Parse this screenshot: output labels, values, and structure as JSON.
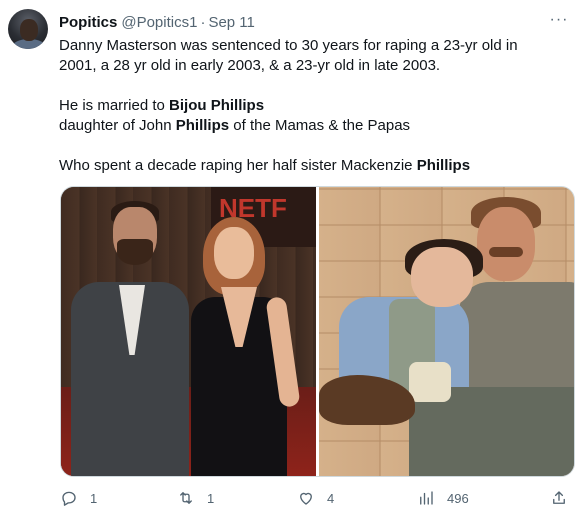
{
  "author": {
    "name": "Popitics",
    "handle": "@Popitics1",
    "separator": "·",
    "date": "Sep 11"
  },
  "more_label": "···",
  "tweet_text": {
    "line1": "Danny Masterson was sentenced to 30 years for raping a 23-yr old in",
    "line2": "2001, a 28 yr old in early 2003, & a 23-yr old in late 2003.",
    "line3_prefix": "He is married to ",
    "line3_bold": "Bijou Phillips",
    "line4_prefix": "daughter of John ",
    "line4_bold": "Phillips",
    "line4_suffix": " of the Mamas & the Papas",
    "line5_prefix": "Who spent a decade raping her half sister Mackenzie ",
    "line5_bold": "Phillips"
  },
  "media": {
    "left_sign_text": "NETF"
  },
  "actions": {
    "reply_count": "1",
    "retweet_count": "1",
    "like_count": "4",
    "views_count": "496"
  }
}
